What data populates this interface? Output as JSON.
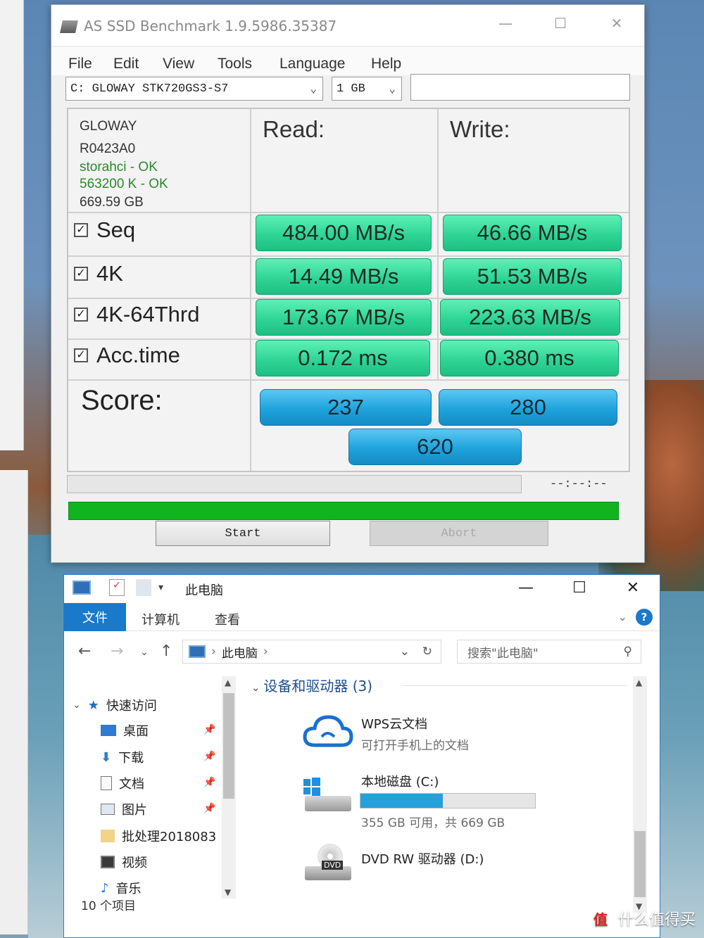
{
  "ssd": {
    "title": "AS SSD Benchmark 1.9.5986.35387",
    "menu": [
      "File",
      "Edit",
      "View",
      "Tools",
      "Language",
      "Help"
    ],
    "drive_select": "C: GLOWAY STK720GS3-S7",
    "size_select": "1 GB",
    "info": {
      "model": "GLOWAY",
      "firmware": "R0423A0",
      "driver": "storahci - OK",
      "alignment": "563200 K - OK",
      "capacity": "669.59 GB"
    },
    "read_header": "Read:",
    "write_header": "Write:",
    "rows": [
      {
        "label": "Seq",
        "read": "484.00 MB/s",
        "write": "46.66 MB/s"
      },
      {
        "label": "4K",
        "read": "14.49 MB/s",
        "write": "51.53 MB/s"
      },
      {
        "label": "4K-64Thrd",
        "read": "173.67 MB/s",
        "write": "223.63 MB/s"
      },
      {
        "label": "Acc.time",
        "read": "0.172 ms",
        "write": "0.380 ms"
      }
    ],
    "score_label": "Score:",
    "score_read": "237",
    "score_write": "280",
    "score_total": "620",
    "time_readout": "--:--:--",
    "start_label": "Start",
    "abort_label": "Abort",
    "colors": {
      "result": "#2fd596",
      "score": "#1fa3dd",
      "progress": "#0fb41e"
    }
  },
  "explorer": {
    "title": "此电脑",
    "ribbon": {
      "file": "文件",
      "tabs": [
        "计算机",
        "查看"
      ]
    },
    "address": "此电脑",
    "search_placeholder": "搜索\"此电脑\"",
    "nav": {
      "quick_access": "快速访问",
      "items": [
        "桌面",
        "下载",
        "文档",
        "图片",
        "批处理2018083",
        "视频",
        "音乐"
      ]
    },
    "group_header": "设备和驱动器 (3)",
    "drives": [
      {
        "name": "WPS云文档",
        "sub": "可打开手机上的文档",
        "icon": "cloud-icon"
      },
      {
        "name": "本地磁盘 (C:)",
        "sub": "355 GB 可用，共 669 GB",
        "icon": "windows-drive-icon",
        "used_fraction": 0.47
      },
      {
        "name": "DVD RW 驱动器 (D:)",
        "sub": "",
        "icon": "dvd-icon"
      }
    ],
    "status": "10 个项目"
  },
  "watermark": {
    "badge": "值",
    "text": "什么值得买"
  }
}
